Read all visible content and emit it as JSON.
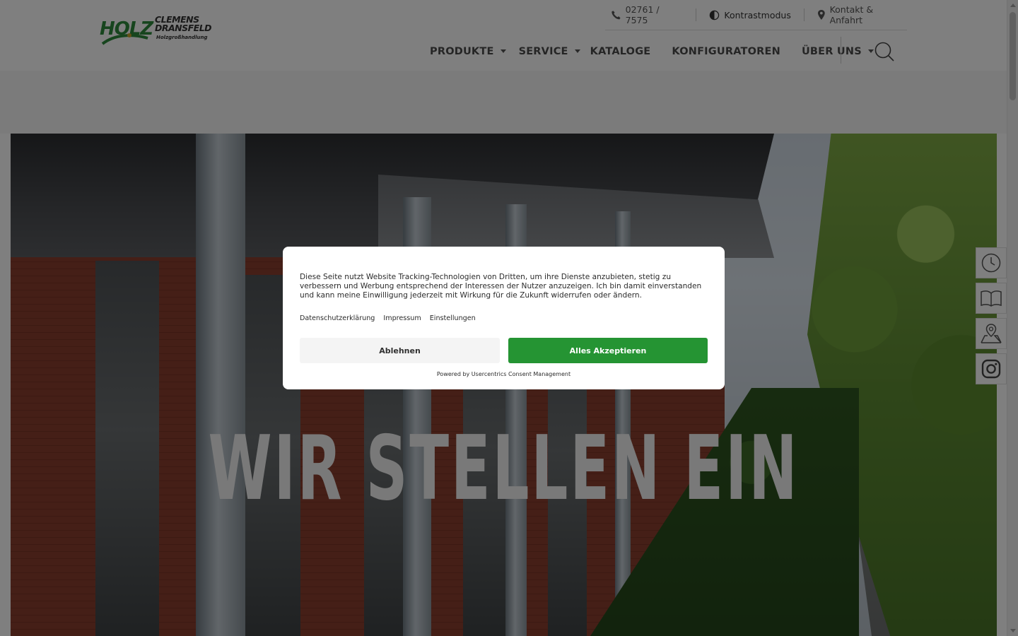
{
  "brand": {
    "logo_word": "HOLZ",
    "name_line1": "CLEMENS",
    "name_line2": "DRANSFELD",
    "tagline": "Holzgroßhandlung",
    "green": "#2f8a3c"
  },
  "topbar": {
    "phone": "02761 / 7575",
    "contrast": "Kontrastmodus",
    "contact": "Kontakt & Anfahrt",
    "icons": [
      "phone-icon",
      "contrast-icon",
      "location-pin-icon"
    ]
  },
  "nav": {
    "items": [
      {
        "label": "PRODUKTE",
        "has_dropdown": true
      },
      {
        "label": "SERVICE",
        "has_dropdown": true
      },
      {
        "label": "KATALOGE",
        "has_dropdown": false
      },
      {
        "label": "KONFIGURATOREN",
        "has_dropdown": false
      },
      {
        "label": "ÜBER UNS",
        "has_dropdown": true
      }
    ],
    "search_icon": "search-icon"
  },
  "hero": {
    "headline": "WIR STELLEN EIN"
  },
  "side_buttons": [
    "clock-icon",
    "book-icon",
    "map-icon",
    "instagram-icon"
  ],
  "consent": {
    "text": "Diese Seite nutzt Website Tracking-Technologien von Dritten, um ihre Dienste anzubieten, stetig zu verbessern und Werbung entsprechend der Interessen der Nutzer anzuzeigen. Ich bin damit einverstanden und kann meine Einwilligung jederzeit mit Wirkung für die Zukunft widerrufen oder ändern.",
    "links": [
      "Datenschutzerklärung",
      "Impressum",
      "Einstellungen"
    ],
    "decline_label": "Ablehnen",
    "accept_label": "Alles Akzeptieren",
    "powered_by": "Powered by Usercentrics Consent Management",
    "accept_color": "#259433"
  }
}
